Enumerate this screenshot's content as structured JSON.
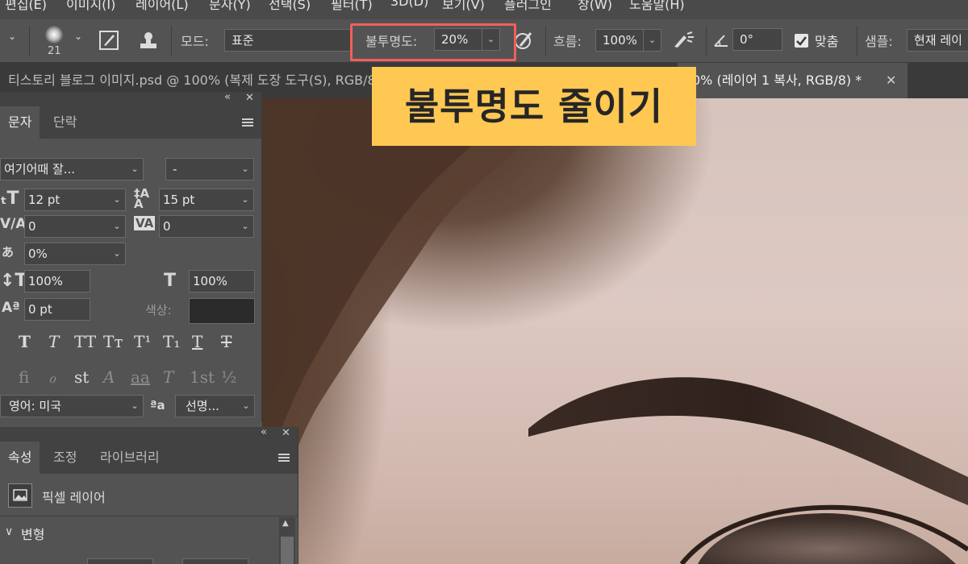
{
  "menu": [
    "편집(E)",
    "이미지(I)",
    "레이어(L)",
    "문자(Y)",
    "선택(S)",
    "필터(T)",
    "3D(D)",
    "보기(V)",
    "플러그인",
    "창(W)",
    "도움말(H)"
  ],
  "options": {
    "brush_size": "21",
    "mode_label": "모드:",
    "mode_value": "표준",
    "opacity_label": "불투명도:",
    "opacity_value": "20%",
    "flow_label": "흐름:",
    "flow_value": "100%",
    "angle_value": "0°",
    "align_label": "맞춤",
    "sample_label": "샘플:",
    "sample_value": "현재 레이"
  },
  "tabs": [
    {
      "title": "티스토리 블로그 이미지.psd @ 100% (복제 도장 도구(S), RGB/8) *"
    },
    {
      "title": "0% (레이어 1 복사, RGB/8) *"
    }
  ],
  "character_panel": {
    "tabs": [
      "문자",
      "단락"
    ],
    "font_family": "여기어때 잘...",
    "font_style": "-",
    "font_size": "12 pt",
    "leading": "15 pt",
    "kerning": "0",
    "tracking": "0",
    "tsume": "0%",
    "vertical_scale": "100%",
    "horizontal_scale": "100%",
    "baseline_shift": "0 pt",
    "color_label": "색상:",
    "style_buttons": [
      "T",
      "T",
      "TT",
      "Tт",
      "T¹",
      "T₁",
      "T",
      "T"
    ],
    "opentype_buttons": [
      "fi",
      "ℴ",
      "st",
      "A",
      "aa",
      "T",
      "1st",
      "½"
    ],
    "language": "영어: 미국",
    "aa_label": "ªa",
    "antialias": "선명..."
  },
  "properties_panel": {
    "tabs": [
      "속성",
      "조정",
      "라이브러리"
    ],
    "layer_kind": "픽셀 레이어",
    "section": "변형"
  },
  "annotation": "불투명도 줄이기",
  "colors": {
    "highlight": "#f0605a",
    "callout_bg": "#ffc853"
  }
}
